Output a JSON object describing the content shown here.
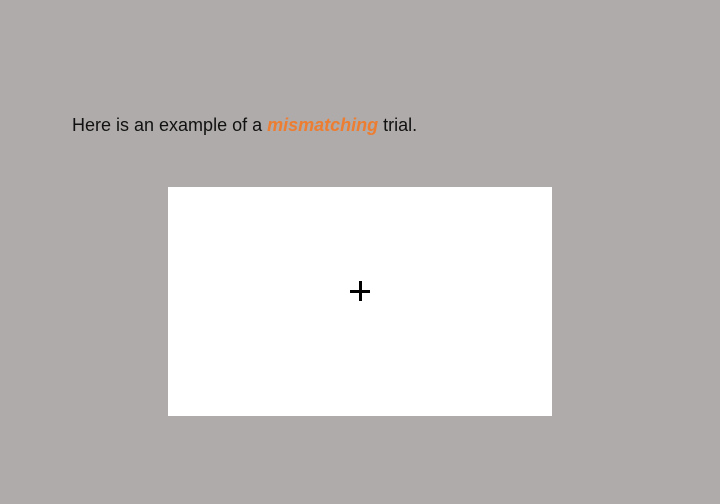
{
  "instruction": {
    "before": "Here is an example of a ",
    "keyword": "mismatching",
    "after": " trial."
  },
  "stimulus": {
    "fixation_symbol": "+"
  },
  "colors": {
    "background": "#afabaa",
    "panel": "#ffffff",
    "keyword": "#ed7d31",
    "text": "#111111"
  }
}
